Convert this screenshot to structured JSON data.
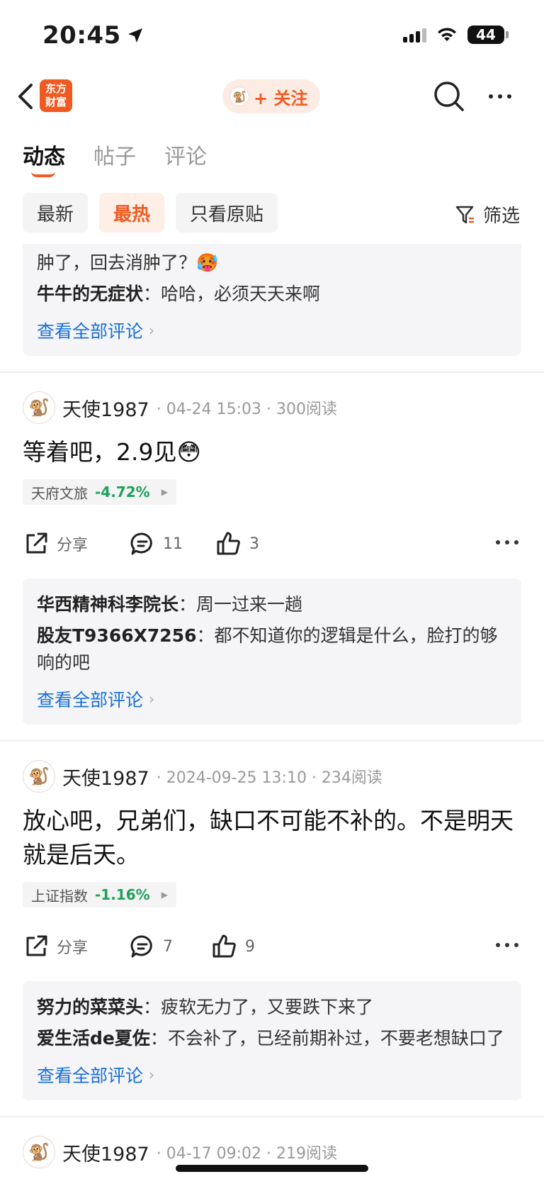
{
  "status": {
    "time": "20:45",
    "battery": "44"
  },
  "nav": {
    "brand": "东方\n财富",
    "follow_label": "+ 关注"
  },
  "tabs": [
    {
      "label": "动态"
    },
    {
      "label": "帖子"
    },
    {
      "label": "评论"
    }
  ],
  "filters": [
    {
      "label": "最新"
    },
    {
      "label": "最热"
    },
    {
      "label": "只看原贴"
    }
  ],
  "filter_button": "筛选",
  "top_block": {
    "replies": [
      {
        "user": "",
        "text": "肿了，回去消肿了？🥵"
      },
      {
        "user": "牛牛的无症状",
        "text": "哈哈，必须天天来啊"
      }
    ],
    "see_all": "查看全部评论"
  },
  "posts": [
    {
      "author": "天使1987",
      "meta": "· 04-24 15:03 · 300阅读",
      "text": "等着吧，2.9见😳",
      "stock_name": "天府文旅",
      "stock_pct": "-4.72%",
      "share_label": "分享",
      "comments": "11",
      "likes": "3",
      "replies": [
        {
          "user": "华西精神科李院长",
          "text": "周一过来一趟"
        },
        {
          "user": "股友T9366X7256",
          "text": "都不知道你的逻辑是什么，脸打的够响的吧"
        }
      ],
      "see_all": "查看全部评论"
    },
    {
      "author": "天使1987",
      "meta": "· 2024-09-25 13:10 · 234阅读",
      "text": "放心吧，兄弟们，缺口不可能不补的。不是明天就是后天。",
      "stock_name": "上证指数",
      "stock_pct": "-1.16%",
      "share_label": "分享",
      "comments": "7",
      "likes": "9",
      "replies": [
        {
          "user": "努力的菜菜头",
          "text": "疲软无力了，又要跌下来了"
        },
        {
          "user": "爱生活de夏佐",
          "text": "不会补了，已经前期补过，不要老想缺口了"
        }
      ],
      "see_all": "查看全部评论"
    },
    {
      "author": "天使1987",
      "meta": "· 04-17 09:02 · 219阅读"
    }
  ],
  "colors": {
    "accent": "#f05a22",
    "link": "#1a6fd8",
    "down": "#1ea15a"
  }
}
